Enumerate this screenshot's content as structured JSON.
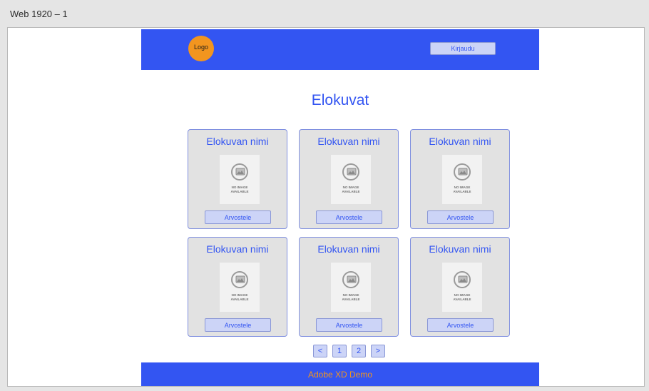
{
  "artboard": {
    "name": "Web 1920 – 1"
  },
  "header": {
    "logo_text": "Logo",
    "login_label": "Kirjaudu"
  },
  "main": {
    "title": "Elokuvat",
    "movies": [
      {
        "title": "Elokuvan nimi",
        "image_text": [
          "NO IMAGE",
          "AVAILABLE"
        ],
        "rate_label": "Arvostele"
      },
      {
        "title": "Elokuvan nimi",
        "image_text": [
          "NO IMAGE",
          "AVAILABLE"
        ],
        "rate_label": "Arvostele"
      },
      {
        "title": "Elokuvan nimi",
        "image_text": [
          "NO IMAGE",
          "AVAILABLE"
        ],
        "rate_label": "Arvostele"
      },
      {
        "title": "Elokuvan nimi",
        "image_text": [
          "NO IMAGE",
          "AVAILABLE"
        ],
        "rate_label": "Arvostele"
      },
      {
        "title": "Elokuvan nimi",
        "image_text": [
          "NO IMAGE",
          "AVAILABLE"
        ],
        "rate_label": "Arvostele"
      },
      {
        "title": "Elokuvan nimi",
        "image_text": [
          "NO IMAGE",
          "AVAILABLE"
        ],
        "rate_label": "Arvostele"
      }
    ]
  },
  "pagination": {
    "prev": "<",
    "pages": [
      "1",
      "2"
    ],
    "next": ">"
  },
  "footer": {
    "text": "Adobe XD Demo"
  },
  "colors": {
    "primary_blue": "#3355f2",
    "accent_orange": "#f2951f",
    "button_fill": "#ccd4f7",
    "card_fill": "#e2e2e2"
  },
  "icons": {
    "placeholder": "no-image-icon"
  }
}
